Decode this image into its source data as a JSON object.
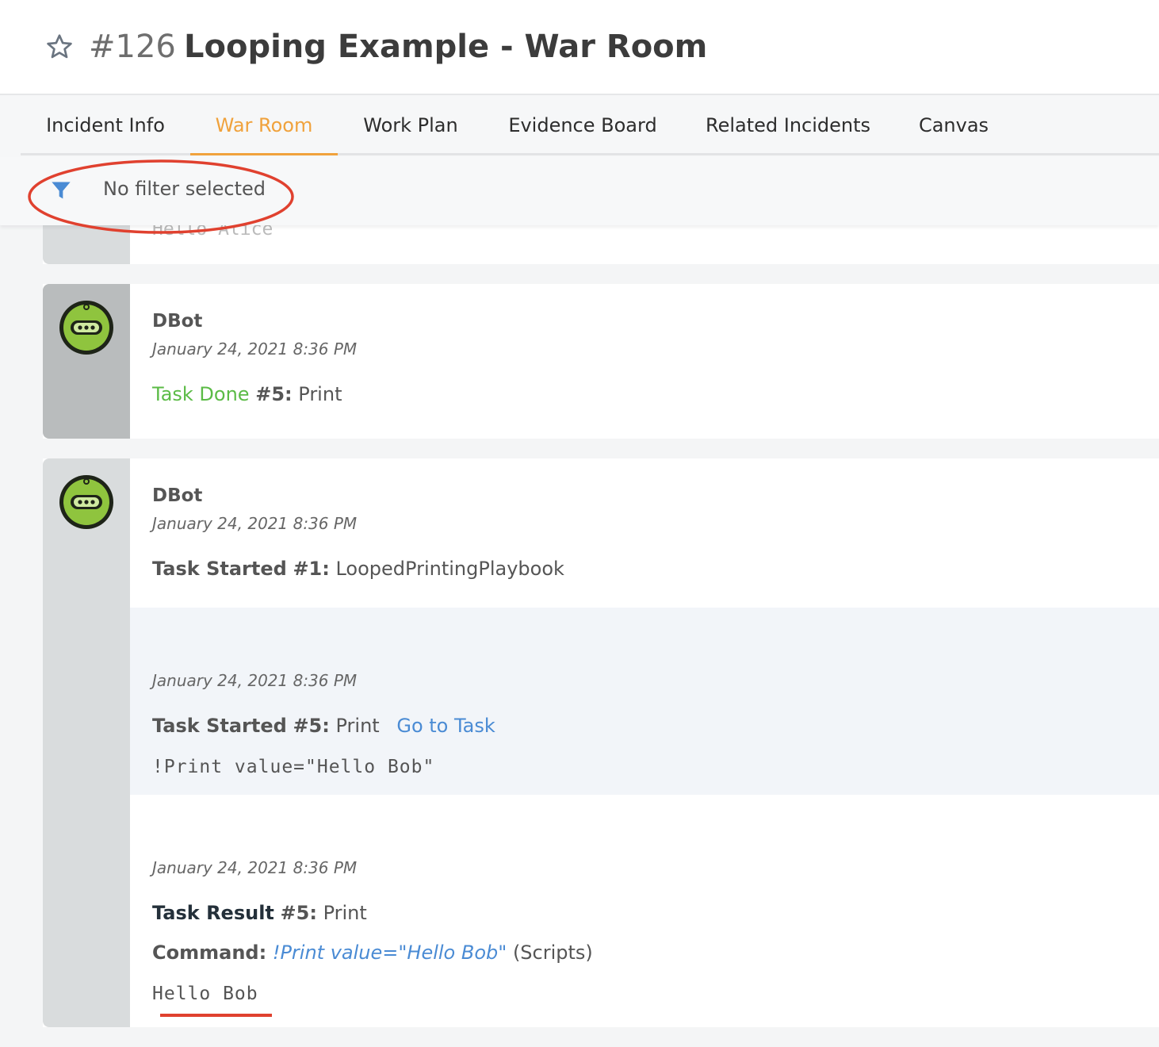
{
  "header": {
    "incident_number": "#126",
    "incident_title": "Looping Example - War Room"
  },
  "tabs": [
    {
      "label": "Incident Info",
      "active": false
    },
    {
      "label": "War Room",
      "active": true
    },
    {
      "label": "Work Plan",
      "active": false
    },
    {
      "label": "Evidence Board",
      "active": false
    },
    {
      "label": "Related Incidents",
      "active": false
    },
    {
      "label": "Canvas",
      "active": false
    }
  ],
  "filter": {
    "label": "No filter selected",
    "icon": "funnel-icon",
    "icon_color": "#4a8bd4"
  },
  "partial_entry": {
    "text": "Hello Alice"
  },
  "entries": [
    {
      "author": "DBot",
      "timestamp": "January 24, 2021 8:36 PM",
      "status": "Task Done",
      "task_ref": "#5:",
      "task_name": "Print"
    },
    {
      "author": "DBot",
      "timestamp": "January 24, 2021 8:36 PM",
      "status": "Task Started",
      "task_ref": "#1:",
      "task_name": "LoopedPrintingPlaybook",
      "sub_started": {
        "timestamp": "January 24, 2021 8:36 PM",
        "status": "Task Started",
        "task_ref": "#5:",
        "task_name": "Print",
        "link": "Go to Task",
        "command": "!Print value=\"Hello Bob\""
      },
      "sub_result": {
        "timestamp": "January 24, 2021 8:36 PM",
        "status": "Task Result",
        "task_ref": "#5:",
        "task_name": "Print",
        "command_label": "Command:",
        "command_link": "!Print value=\"Hello Bob\"",
        "command_source": "(Scripts)",
        "output": "Hello Bob"
      }
    }
  ],
  "colors": {
    "accent_tab": "#f0a23c",
    "task_done": "#5bbb46",
    "link": "#4a8bd4",
    "annotation_red": "#e0412f"
  }
}
